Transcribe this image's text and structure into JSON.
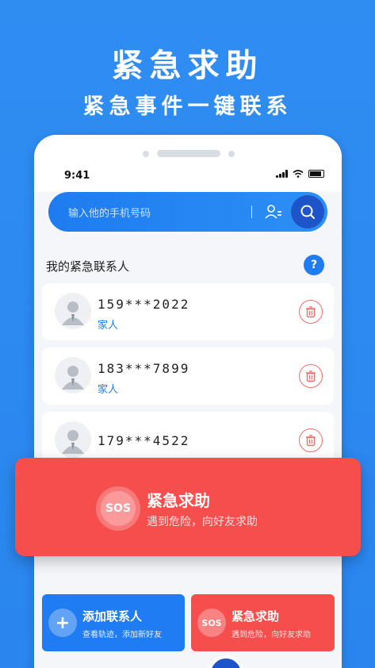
{
  "hero": {
    "title": "紧急求助",
    "subtitle": "紧急事件一键联系"
  },
  "status_bar": {
    "time": "9:41"
  },
  "search": {
    "placeholder": "输入他的手机号码"
  },
  "contacts_section": {
    "title": "我的紧急联系人",
    "help_label": "?"
  },
  "contacts": [
    {
      "phone": "159***2022",
      "relation": "家人"
    },
    {
      "phone": "183***7899",
      "relation": "家人"
    },
    {
      "phone": "179***4522",
      "relation": ""
    }
  ],
  "sos_banner": {
    "badge": "SOS",
    "title": "紧急求助",
    "description": "遇到危险，向好友求助"
  },
  "bottom_actions": {
    "add": {
      "icon_label": "+",
      "title": "添加联系人",
      "description": "查看轨迹，添加新好友"
    },
    "sos": {
      "badge": "SOS",
      "title": "紧急求助",
      "description": "遇到危险，向好友求助"
    }
  },
  "colors": {
    "primary_blue": "#1f7cf2",
    "sos_red": "#f64d4d",
    "background_blue": "#2f8df2"
  }
}
